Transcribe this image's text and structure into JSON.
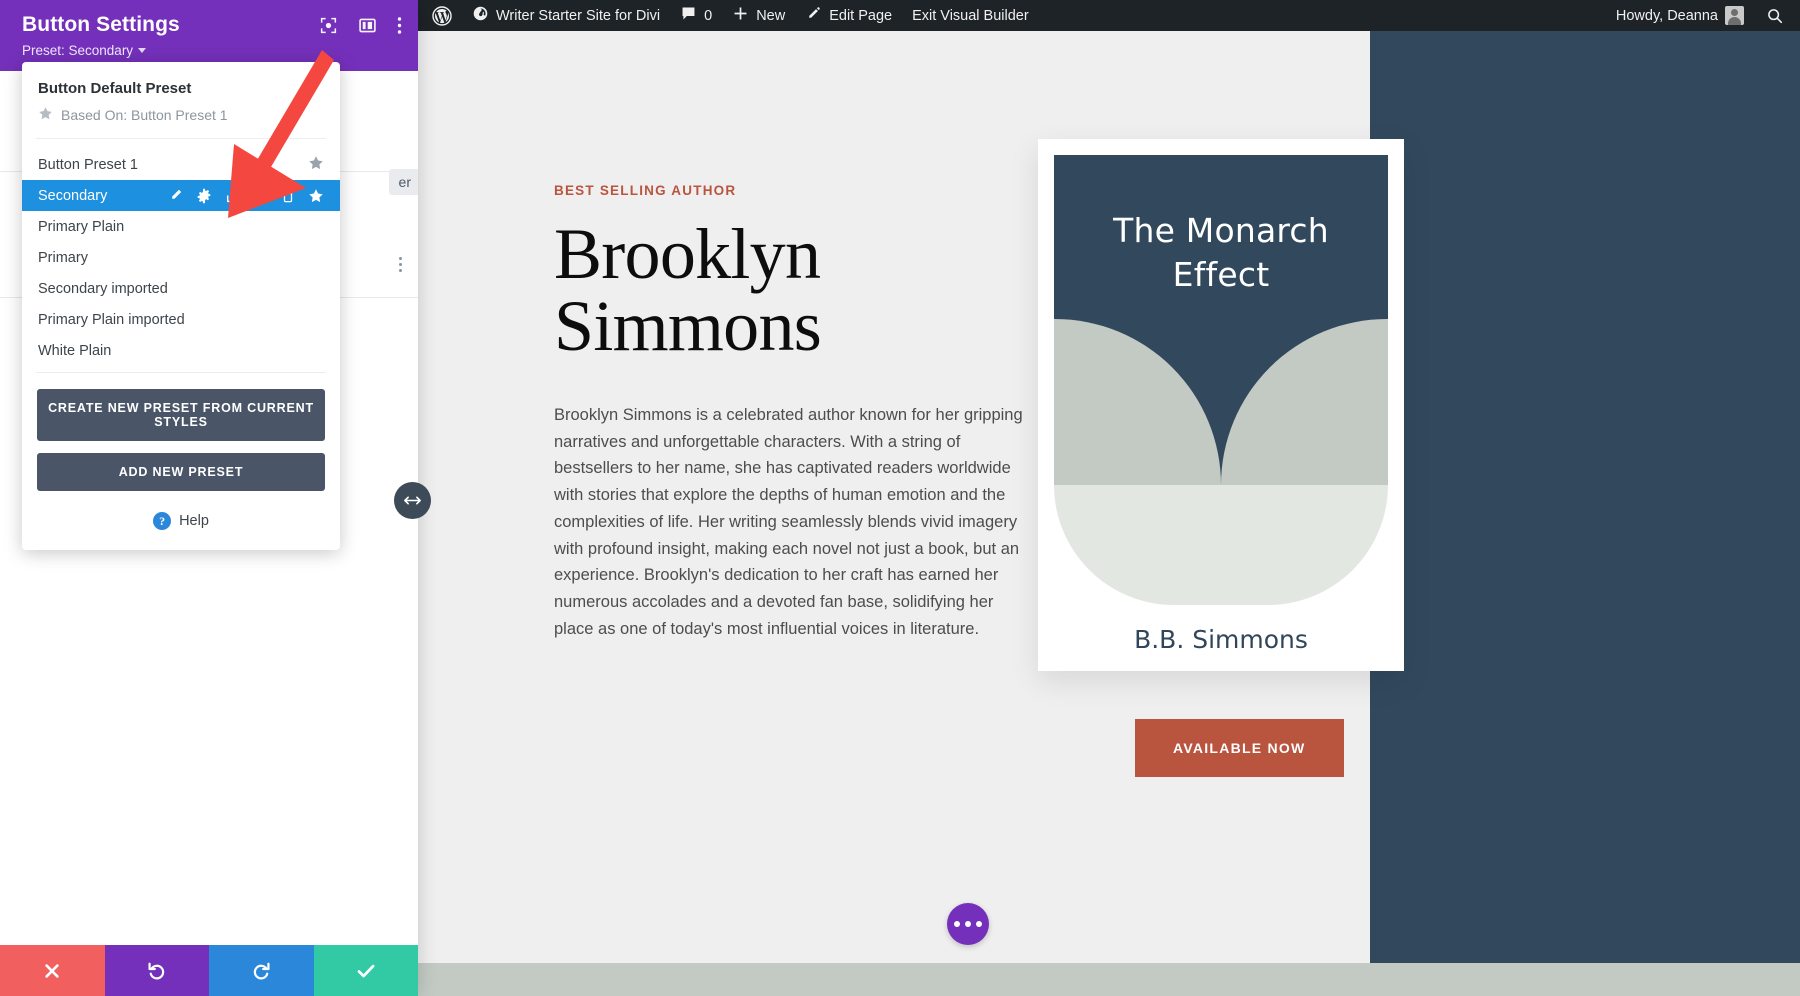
{
  "adminbar": {
    "logo_icon": "wordpress-logo-icon",
    "site_icon": "dashboard-icon",
    "site_name": "Writer Starter Site for Divi",
    "comments_icon": "comment-bubble-icon",
    "comments_count": "0",
    "new_icon": "plus-icon",
    "new_label": "New",
    "edit_icon": "pencil-icon",
    "edit_label": "Edit Page",
    "exit_label": "Exit Visual Builder",
    "howdy": "Howdy, Deanna",
    "avatar_icon": "user-avatar-icon",
    "search_icon": "search-icon"
  },
  "settings": {
    "title": "Button Settings",
    "preset_line": "Preset: Secondary",
    "header_icons": [
      {
        "name": "responsive-preview-icon"
      },
      {
        "name": "layout-columns-icon"
      },
      {
        "name": "vertical-dots-icon"
      }
    ],
    "ghost_tab_label": "er",
    "footer": [
      {
        "name": "cancel-button",
        "icon": "close-x-icon",
        "color": "#f15f5f"
      },
      {
        "name": "undo-button",
        "icon": "undo-arrow-icon",
        "color": "#7430ba"
      },
      {
        "name": "redo-button",
        "icon": "redo-arrow-icon",
        "color": "#2b87da"
      },
      {
        "name": "save-button",
        "icon": "checkmark-icon",
        "color": "#32c9a5"
      }
    ]
  },
  "preset_panel": {
    "default_preset_label": "Button Default Preset",
    "based_on_label": "Based On: Button Preset 1",
    "based_on_icon": "star-icon",
    "items": [
      {
        "label": "Button Preset 1",
        "active": false,
        "has_star": true
      },
      {
        "label": "Secondary",
        "active": true,
        "has_star": true
      },
      {
        "label": "Primary Plain",
        "active": false,
        "has_star": false
      },
      {
        "label": "Primary",
        "active": false,
        "has_star": false
      },
      {
        "label": "Secondary imported",
        "active": false,
        "has_star": false
      },
      {
        "label": "Primary Plain imported",
        "active": false,
        "has_star": false
      },
      {
        "label": "White Plain",
        "active": false,
        "has_star": false
      }
    ],
    "active_actions": [
      {
        "name": "rename-preset-icon"
      },
      {
        "name": "preset-settings-gear-icon"
      },
      {
        "name": "export-preset-icon"
      },
      {
        "name": "duplicate-preset-icon"
      },
      {
        "name": "delete-preset-icon"
      },
      {
        "name": "set-default-star-icon"
      }
    ],
    "create_button_label": "CREATE NEW PRESET FROM CURRENT STYLES",
    "add_button_label": "ADD NEW PRESET",
    "help_label": "Help",
    "help_icon": "question-mark-icon"
  },
  "page": {
    "eyebrow": "BEST SELLING AUTHOR",
    "title_line1": "Brooklyn",
    "title_line2": "Simmons",
    "body": "Brooklyn Simmons is a celebrated author known for her gripping narratives and unforgettable characters. With a string of bestsellers to her name, she has captivated readers worldwide with stories that explore the depths of human emotion and the complexities of life. Her writing seamlessly blends vivid imagery with profound insight, making each novel not just a book, but an experience. Brooklyn's dedication to her craft has earned her numerous accolades and a devoted fan base, solidifying her place as one of today's most influential voices in literature.",
    "book_title_line1": "The Monarch",
    "book_title_line2": "Effect",
    "book_author": "B.B. Simmons",
    "cta_label": "AVAILABLE NOW",
    "fab_icon": "ellipsis-icon",
    "resize_icon": "horizontal-resize-arrows-icon"
  },
  "colors": {
    "accent_purple": "#7430ba",
    "active_blue": "#1e90e0",
    "dark_navy": "#32495d",
    "terracotta": "#b9543f",
    "slate_button": "#4a5668"
  }
}
